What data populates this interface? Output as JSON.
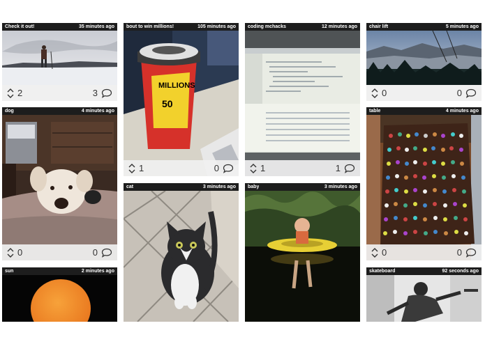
{
  "cards": [
    {
      "title": "Check it out!",
      "time": "35 minutes ago",
      "votes": "2",
      "comments": "3"
    },
    {
      "title": "bout to win millions!",
      "time": "105 minutes ago",
      "votes": "1",
      "comments": "0"
    },
    {
      "title": "coding mchacks",
      "time": "12 minutes ago",
      "votes": "1",
      "comments": "1"
    },
    {
      "title": "chair lift",
      "time": "5 minutes ago",
      "votes": "0",
      "comments": "0"
    },
    {
      "title": "dog",
      "time": "4 minutes ago",
      "votes": "0",
      "comments": "0"
    },
    {
      "title": "table",
      "time": "4 minutes ago",
      "votes": "0",
      "comments": "0"
    },
    {
      "title": "cat",
      "time": "3 minutes ago"
    },
    {
      "title": "baby",
      "time": "3 minutes ago"
    },
    {
      "title": "sun",
      "time": "2 minutes ago"
    },
    {
      "title": "skateboard",
      "time": "92 seconds ago"
    }
  ],
  "cup_text": {
    "brand": "MILLIONS",
    "amount": "50"
  },
  "icons": {
    "vote": "up-down-arrows-icon",
    "comment": "speech-bubble-icon"
  }
}
